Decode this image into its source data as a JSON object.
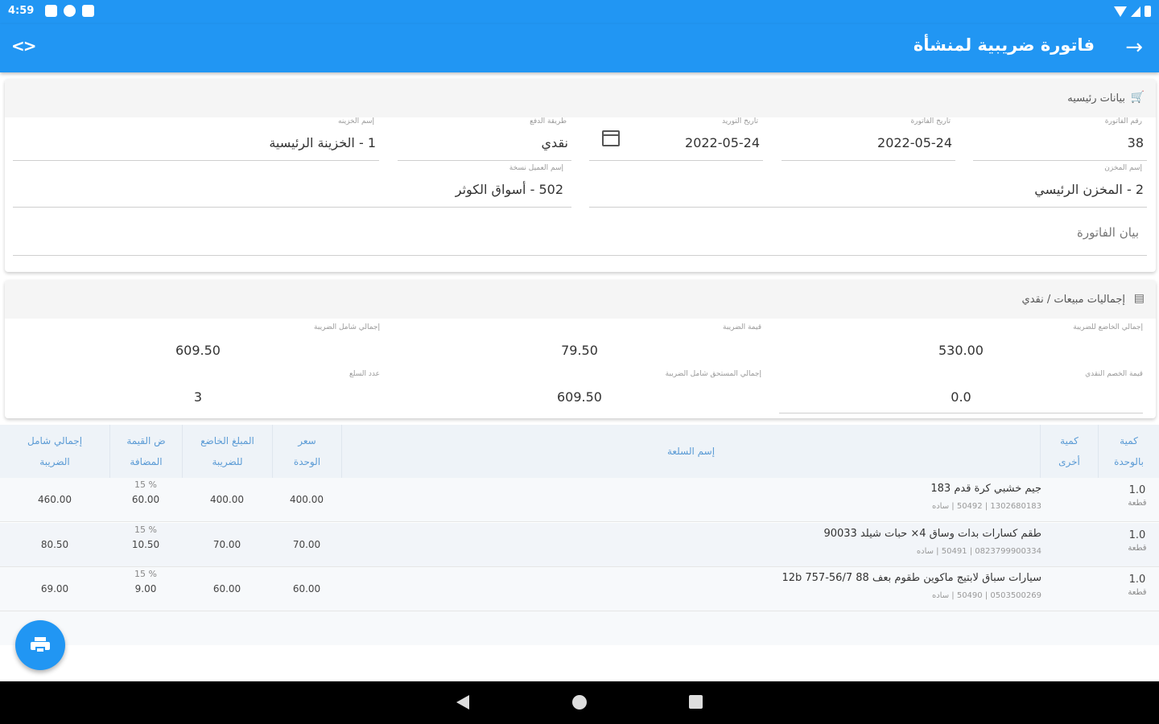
{
  "status": {
    "time": "4:59"
  },
  "app_bar": {
    "title": "فاتورة ضريبية لمنشأة"
  },
  "main_card": {
    "header": "بيانات رئيسيه",
    "fields": {
      "invoice_no": {
        "label": "رقم الفاتورة",
        "value": "38"
      },
      "invoice_date": {
        "label": "تاريخ الفاتورة",
        "value": "2022-05-24"
      },
      "supply_date": {
        "label": "تاريخ التوريد",
        "value": "2022-05-24"
      },
      "payment_method": {
        "label": "طريقة الدفع",
        "value": "نقدي"
      },
      "treasury": {
        "label": "إسم الخزينه",
        "value": "1 - الخزينة الرئيسية"
      },
      "warehouse": {
        "label": "إسم المخزن",
        "value": "2 - المخزن الرئيسي"
      },
      "customer": {
        "label": "إسم العميل نسخة",
        "value": "502 - أسواق الكوثر"
      },
      "invoice_statement": {
        "placeholder": "بيان الفاتورة"
      }
    }
  },
  "totals_card": {
    "header": "إجماليات مبيعات / نقدي",
    "fields": {
      "taxable_total": {
        "label": "إجمالي الخاضع للضريبة",
        "value": "530.00"
      },
      "tax_value": {
        "label": "قيمة الضريبة",
        "value": "79.50"
      },
      "total_incl_tax": {
        "label": "إجمالي شامل الضريبة",
        "value": "609.50"
      },
      "cash_discount": {
        "label": "قيمة الخصم النقدي",
        "value": "0.0"
      },
      "due_incl_tax": {
        "label": "إجمالي المستحق شامل الضريبة",
        "value": "609.50"
      },
      "items_count": {
        "label": "عدد السلع",
        "value": "3"
      }
    }
  },
  "table": {
    "headers": {
      "qty_unit": [
        "كمية",
        "بالوحدة"
      ],
      "qty_other": [
        "كمية",
        "أخرى"
      ],
      "item_name": "إسم السلعة",
      "unit_price": [
        "سعر",
        "الوحدة"
      ],
      "taxable_amount": [
        "المبلغ الخاضع",
        "للضريبة"
      ],
      "vat": [
        "ض القيمة",
        "المضافة"
      ],
      "total_incl_tax": [
        "إجمالي شامل",
        "الضريبة"
      ]
    },
    "rows": [
      {
        "qty": "1.0",
        "unit": "قطعة",
        "name": "جيم خشبي كرة قدم 183",
        "sub": "1302680183 | 50492 | ساده",
        "price": "400.00",
        "taxable": "400.00",
        "vat_pct": "15 %",
        "vat": "60.00",
        "total": "460.00"
      },
      {
        "qty": "1.0",
        "unit": "قطعة",
        "name": "طقم كسارات بدات وساق 4× حبات شيلد 90033",
        "sub": "0823799900334 | 50491 | ساده",
        "price": "70.00",
        "taxable": "70.00",
        "vat_pct": "15 %",
        "vat": "10.50",
        "total": "80.50"
      },
      {
        "qty": "1.0",
        "unit": "قطعة",
        "name": "سيارات سباق لابتيج ماكوين طقوم بعف 12b 757-56/7 88",
        "sub": "0503500269 | 50490 | ساده",
        "price": "60.00",
        "taxable": "60.00",
        "vat_pct": "15 %",
        "vat": "9.00",
        "total": "69.00"
      }
    ]
  },
  "icons": {
    "back": "arrow-right-icon",
    "code": "code-icon",
    "cart": "cart-icon",
    "document": "document-icon",
    "calendar": "calendar-icon",
    "print": "print-icon"
  },
  "colors": {
    "primary": "#2196f3",
    "header_text": "#5b9bd5"
  }
}
